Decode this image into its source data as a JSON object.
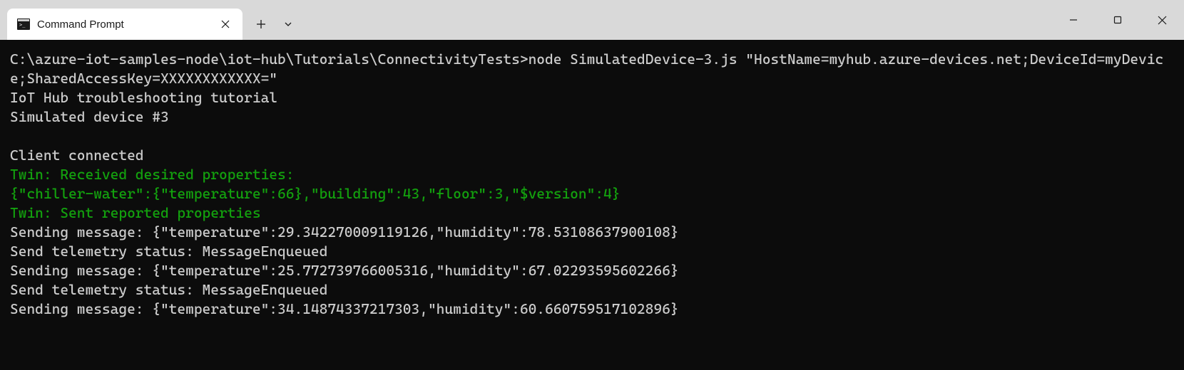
{
  "window": {
    "tab_title": "Command Prompt"
  },
  "terminal": {
    "lines": [
      {
        "text": "C:\\azure-iot-samples-node\\iot-hub\\Tutorials\\ConnectivityTests>node SimulatedDevice-3.js \"HostName=myhub.azure-devices.net;DeviceId=myDevice;SharedAccessKey=XXXXXXXXXXXX=\"",
        "color": "normal"
      },
      {
        "text": "IoT Hub troubleshooting tutorial",
        "color": "normal"
      },
      {
        "text": "Simulated device #3",
        "color": "normal"
      },
      {
        "text": "",
        "color": "normal"
      },
      {
        "text": "Client connected",
        "color": "normal"
      },
      {
        "text": "Twin: Received desired properties:",
        "color": "green"
      },
      {
        "text": "{\"chiller-water\":{\"temperature\":66},\"building\":43,\"floor\":3,\"$version\":4}",
        "color": "green"
      },
      {
        "text": "Twin: Sent reported properties",
        "color": "green"
      },
      {
        "text": "Sending message: {\"temperature\":29.342270009119126,\"humidity\":78.53108637900108}",
        "color": "normal"
      },
      {
        "text": "Send telemetry status: MessageEnqueued",
        "color": "normal"
      },
      {
        "text": "Sending message: {\"temperature\":25.772739766005316,\"humidity\":67.02293595602266}",
        "color": "normal"
      },
      {
        "text": "Send telemetry status: MessageEnqueued",
        "color": "normal"
      },
      {
        "text": "Sending message: {\"temperature\":34.14874337217303,\"humidity\":60.660759517102896}",
        "color": "normal"
      }
    ]
  }
}
